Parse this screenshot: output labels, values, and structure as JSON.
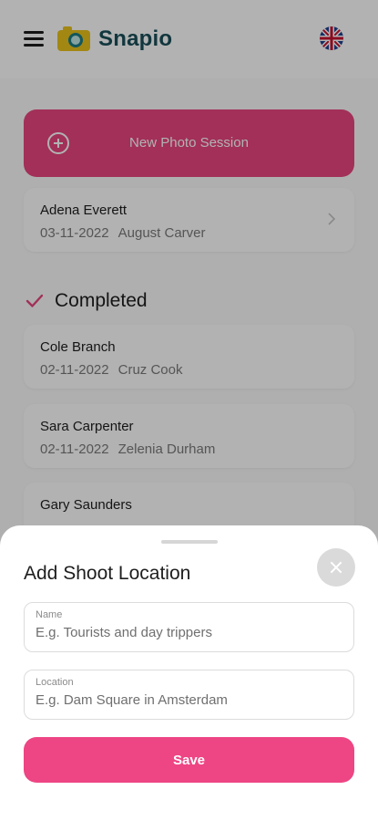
{
  "header": {
    "app_name": "Snapio",
    "menu_icon": "hamburger-menu-icon",
    "logo_icon": "camera-icon",
    "language_icon": "uk-flag-icon"
  },
  "new_session": {
    "label": "New Photo Session",
    "icon": "plus-circle-icon"
  },
  "active_sessions": [
    {
      "name": "Adena Everett",
      "date": "03-11-2022",
      "photographer": "August Carver"
    }
  ],
  "completed_section": {
    "title": "Completed",
    "icon": "check-icon",
    "sessions": [
      {
        "name": "Cole Branch",
        "date": "02-11-2022",
        "photographer": "Cruz Cook"
      },
      {
        "name": "Sara Carpenter",
        "date": "02-11-2022",
        "photographer": "Zelenia Durham"
      },
      {
        "name": "Gary Saunders"
      }
    ]
  },
  "sheet": {
    "title": "Add Shoot Location",
    "name_field": {
      "label": "Name",
      "placeholder": "E.g. Tourists and day trippers",
      "value": ""
    },
    "location_field": {
      "label": "Location",
      "placeholder": "E.g. Dam Square in Amsterdam",
      "value": ""
    },
    "save_label": "Save"
  },
  "colors": {
    "accent": "#e8457f",
    "save_button": "#ee4584",
    "brand_text": "#1b4f5a",
    "logo_yellow": "#e8c21c",
    "logo_teal": "#1b7d86",
    "overlay": "rgba(0,0,0,0.30)"
  }
}
